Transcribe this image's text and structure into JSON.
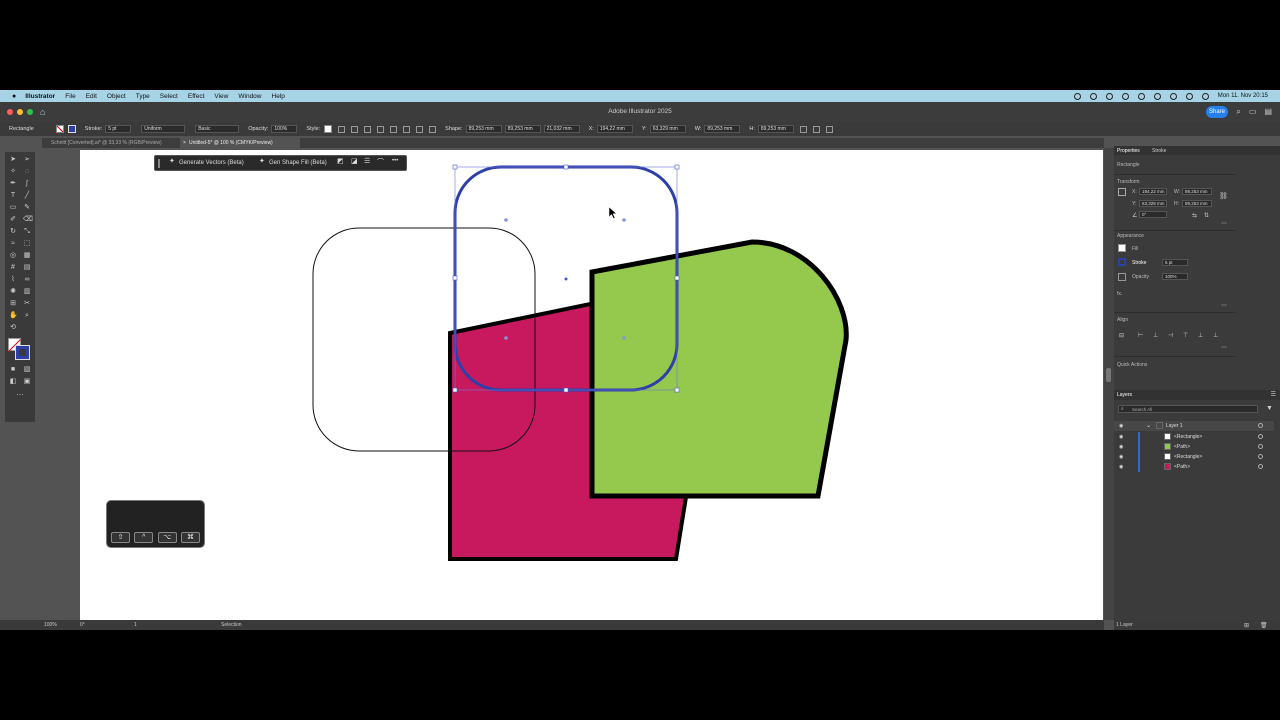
{
  "menubar": {
    "app_name": "Illustrator",
    "items": [
      "File",
      "Edit",
      "Object",
      "Type",
      "Select",
      "Effect",
      "View",
      "Window",
      "Help"
    ],
    "clock": "Mon 11. Nov 20:15"
  },
  "titlebar": {
    "title": "Adobe Illustrator 2025",
    "share_label": "Share"
  },
  "controlbar": {
    "selection_type": "Rectangle",
    "stroke_label": "Stroke:",
    "stroke_value": "5 pt",
    "profile_value": "Uniform",
    "brush_value": "Basic",
    "opacity_label": "Opacity:",
    "opacity_value": "100%",
    "style_label": "Style:",
    "shape_label": "Shape:",
    "shape_w": "89,253 mm",
    "shape_h": "89,253 mm",
    "angle": "21,032 mm",
    "x_label": "X:",
    "x_value": "194,22 mm",
    "y_label": "Y:",
    "y_value": "63,329 mm",
    "w_label": "W:",
    "w_value": "89,253 mm",
    "h_label": "H:",
    "h_value": "89,253 mm"
  },
  "tabs": [
    {
      "label": "Schnitt [Converted].ai* @ 33,33 % (RGB/Preview)"
    },
    {
      "label": "Untitled-5* @ 100 % (CMYK/Preview)"
    }
  ],
  "taskbar": {
    "generate_vectors": "Generate Vectors (Beta)",
    "gen_shape_fill": "Gen Shape Fill (Beta)",
    "more": "•••"
  },
  "hud": {
    "keys": [
      "⇧",
      "^",
      "⌥",
      "⌘"
    ]
  },
  "properties": {
    "tabs": [
      "Properties",
      "Stroke"
    ],
    "object_type": "Rectangle",
    "transform_label": "Transform",
    "x_label": "X:",
    "x_value": "194,22 mm",
    "w_label": "W:",
    "w_value": "89,253 mm",
    "y_label": "Y:",
    "y_value": "63,329 mm",
    "h_label": "H:",
    "h_value": "89,253 mm",
    "angle_value": "0°",
    "appearance_label": "Appearance",
    "fill_label": "Fill",
    "stroke_label": "Stroke",
    "stroke_value": "5 pt",
    "opacity_label": "Opacity",
    "opacity_value": "100%",
    "fx_label": "fx.",
    "align_label": "Align",
    "quick_actions_label": "Quick Actions"
  },
  "layers": {
    "title": "Layers",
    "search_placeholder": "Search All",
    "rows": [
      {
        "name": "Layer 1",
        "color": "#ffffff"
      },
      {
        "name": "<Rectangle>",
        "color": "#ffffff"
      },
      {
        "name": "<Path>",
        "color": "#8fc94a"
      },
      {
        "name": "<Rectangle>",
        "color": "#ffffff"
      },
      {
        "name": "<Path>",
        "color": "#c8195f"
      }
    ],
    "count": "1 Layer"
  },
  "statusbar": {
    "zoom": "100%",
    "rotation": "0°",
    "artboard": "1",
    "tool": "Selection"
  },
  "colors": {
    "green_shape": "#94c94e",
    "magenta_shape": "#c8195f",
    "selection": "#2f3fa8"
  }
}
